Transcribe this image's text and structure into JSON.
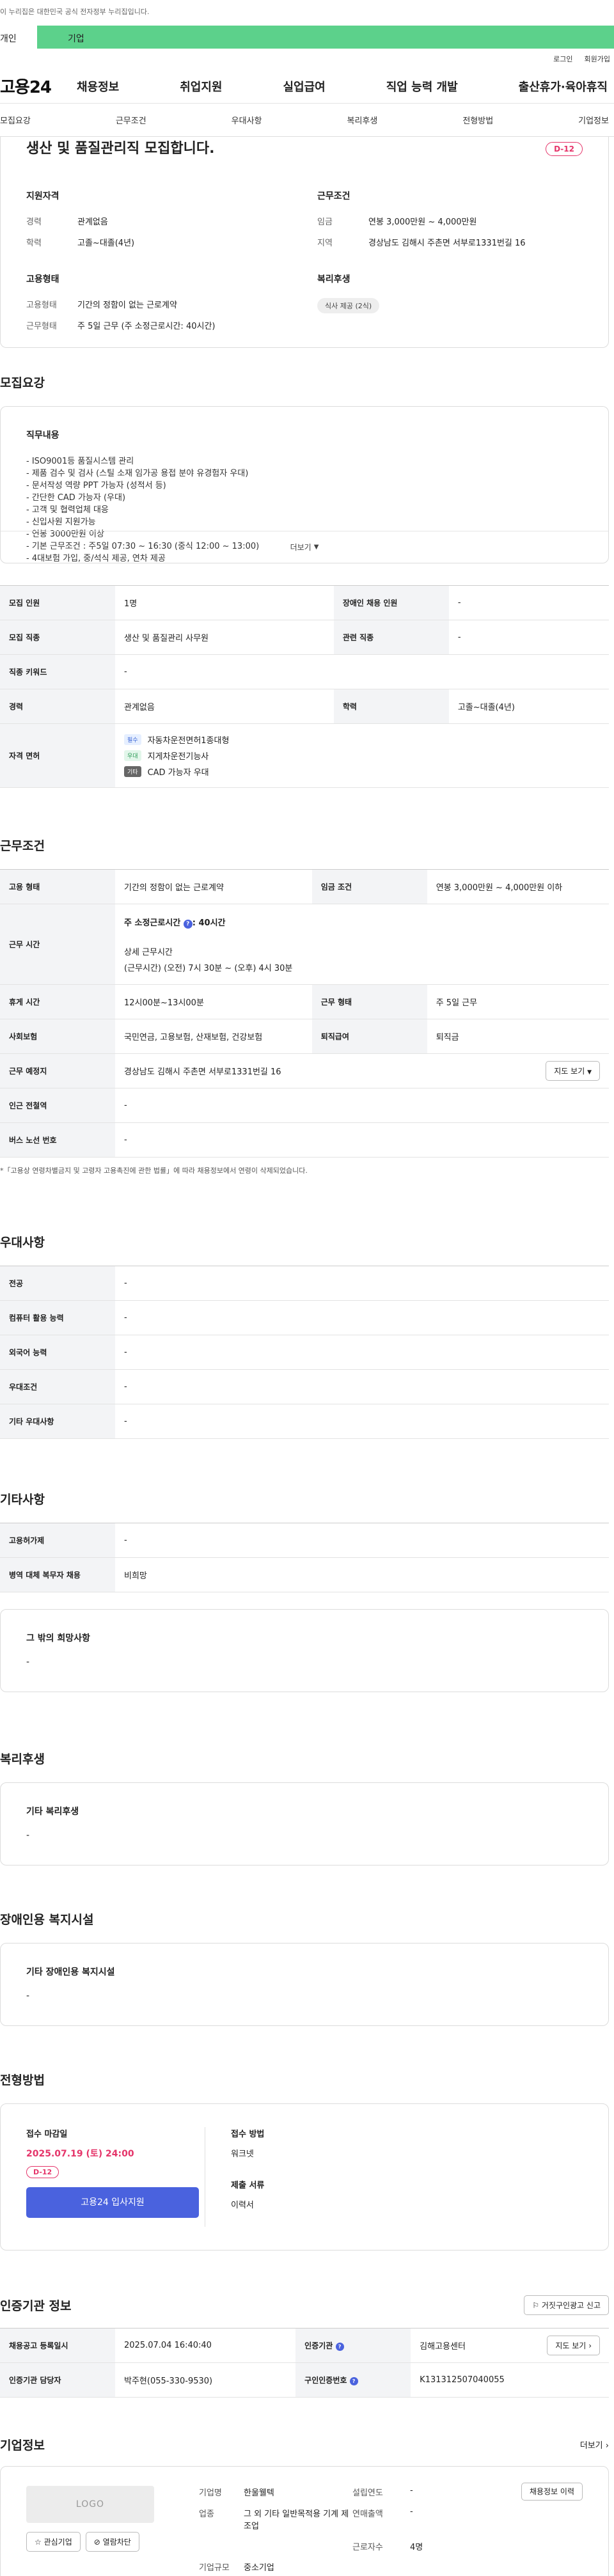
{
  "gov_notice": "이 누리집은 대한민국 공식 전자정부 누리집입니다.",
  "member_tabs": {
    "person": "개인",
    "corporate": "기업"
  },
  "util": {
    "login": "로그인",
    "join": "회원가입"
  },
  "gnb": {
    "logo": "고용24",
    "menu": [
      "채용정보",
      "취업지원",
      "실업급여",
      "직업 능력 개발",
      "출산휴가·육아휴직"
    ]
  },
  "anchors": [
    "모집요강",
    "근무조건",
    "우대사항",
    "복리후생",
    "전형방법",
    "기업정보"
  ],
  "summary": {
    "title": "생산 및 품질관리직 모집합니다.",
    "dday": "D-12",
    "qual_title": "지원자격",
    "qual": [
      {
        "k": "경력",
        "v": "관계없음"
      },
      {
        "k": "학력",
        "v": "고졸~대졸(4년)"
      }
    ],
    "cond_title": "근무조건",
    "cond": [
      {
        "k": "임금",
        "v": "연봉 3,000만원 ~ 4,000만원"
      },
      {
        "k": "지역",
        "v": "경상남도 김해시 주촌면 서부로1331번길 16"
      }
    ],
    "emp_title": "고용형태",
    "emp": [
      {
        "k": "고용형태",
        "v": "기간의 정함이 없는 근로계약"
      },
      {
        "k": "근무형태",
        "v": "주 5일 근무 (주 소정근로시간: 40시간)"
      }
    ],
    "welfare_title": "복리후생",
    "welfare_pill": "식사 제공 (2식)"
  },
  "recruit": {
    "title": "모집요강",
    "job_title": "직무내용",
    "lines": [
      "- ISO9001등 품질시스템 관리",
      "- 제품 검수 및 검사 (스틸 소재 임가공 용접 분야 유경험자 우대)",
      "- 문서작성 역량 PPT 가능자 (성적서 등)",
      "- 간단한 CAD 가능자 (우대)",
      "- 고객 및 협력업체 대응",
      "- 신입사원 지원가능",
      "- 연봉 3000만원 이상",
      "- 기본 근무조건 : 주5일  07:30 ~ 16:30 (중식 12:00 ~ 13:00)",
      "- 4대보험 가입, 중/석식 제공, 연차 제공"
    ],
    "more": "더보기",
    "table": {
      "headcount_k": "모집 인원",
      "headcount_v": "1명",
      "disabled_k": "장애인 채용 인원",
      "disabled_v": "-",
      "occupation_k": "모집 직종",
      "occupation_v": "생산 및 품질관리 사무원",
      "related_k": "관련 직종",
      "related_v": "-",
      "keyword_k": "직종 키워드",
      "keyword_v": "-",
      "career_k": "경력",
      "career_v": "관계없음",
      "edu_k": "학력",
      "edu_v": "고졸~대졸(4년)",
      "license_k": "자격 면허",
      "licenses": [
        {
          "tag": "필수",
          "name": "자동차운전면허1종대형"
        },
        {
          "tag": "우대",
          "name": "지게차운전기능사"
        },
        {
          "tag": "기타",
          "name": "CAD 가능자 우대"
        }
      ]
    }
  },
  "work": {
    "title": "근무조건",
    "emp_k": "고용 형태",
    "emp_v": "기간의 정함이 없는 근로계약",
    "wage_k": "임금 조건",
    "wage_v": "연봉 3,000만원 ~ 4,000만원 이하",
    "hours_k": "근무 시간",
    "hours_weekly": "주 소정근로시간",
    "hours_weekly_v": ": 40시간",
    "hours_detail_title": "상세 근무시간",
    "hours_detail": "(근무시간) (오전) 7시 30분 ~ (오후) 4시 30분",
    "break_k": "휴게 시간",
    "break_v": "12시00분~13시00분",
    "form_k": "근무 형태",
    "form_v": "주 5일 근무",
    "insurance_k": "사회보험",
    "insurance_v": "국민연금, 고용보험, 산재보험, 건강보험",
    "retire_k": "퇴직급여",
    "retire_v": "퇴직금",
    "place_k": "근무 예정지",
    "place_v": "경상남도 김해시 주촌면 서부로1331번길 16",
    "map_btn": "지도 보기",
    "subway_k": "인근 전철역",
    "subway_v": "-",
    "bus_k": "버스 노선 번호",
    "bus_v": "-",
    "note": "*「고용상 연령차별금지 및 고령자 고용촉진에 관한 법률」에 따라 채용정보에서 연령이 삭제되었습니다."
  },
  "pref": {
    "title": "우대사항",
    "rows": [
      {
        "k": "전공",
        "v": "-"
      },
      {
        "k": "컴퓨터 활용 능력",
        "v": "-"
      },
      {
        "k": "외국어 능력",
        "v": "-"
      },
      {
        "k": "우대조건",
        "v": "-"
      },
      {
        "k": "기타 우대사항",
        "v": "-"
      }
    ]
  },
  "etc": {
    "title": "기타사항",
    "rows": [
      {
        "k": "고용허가제",
        "v": "-"
      },
      {
        "k": "병역 대체 복무자 채용",
        "v": "비희망"
      }
    ],
    "other_title": "그 밖의 희망사항",
    "other_v": "-"
  },
  "welfare": {
    "title": "복리후생",
    "sub": "기타 복리후생",
    "v": "-"
  },
  "disabled": {
    "title": "장애인용 복지시설",
    "sub": "기타 장애인용 복지시설",
    "v": "-"
  },
  "apply": {
    "title": "전형방법",
    "deadline_k": "접수 마감일",
    "deadline_v": "2025.07.19 (토) 24:00",
    "dday": "D-12",
    "apply_btn": "고용24 입사지원",
    "method_k": "접수 방법",
    "method_v": "워크넷",
    "docs_k": "제출 서류",
    "docs_v": "이력서"
  },
  "certify": {
    "title": "인증기관 정보",
    "report_btn": "거짓구인광고 신고",
    "reg_k": "채용공고 등록일시",
    "reg_v": "2025.07.04 16:40:40",
    "org_k": "인증기관",
    "org_v": "김해고용센터",
    "map_btn": "지도 보기",
    "mgr_k": "인증기관 담당자",
    "mgr_v": "박주현(055-330-9530)",
    "id_k": "구인인증번호",
    "id_v": "K131312507040055"
  },
  "company": {
    "title": "기업정보",
    "more": "더보기",
    "logo": "LOGO",
    "fav_btn": "관심기업",
    "block_btn": "열람차단",
    "history_btn": "채용정보 이력",
    "name_k": "기업명",
    "name_v": "한울웰텍",
    "found_k": "설립연도",
    "found_v": "-",
    "industry_k": "업종",
    "industry_v": "그 외 기타 일반목적용 기계 제조업",
    "sales_k": "연매출액",
    "sales_v": "-",
    "emp_k": "근로자수",
    "emp_v": "4명",
    "size_k": "기업규모",
    "size_v": "중소기업"
  }
}
